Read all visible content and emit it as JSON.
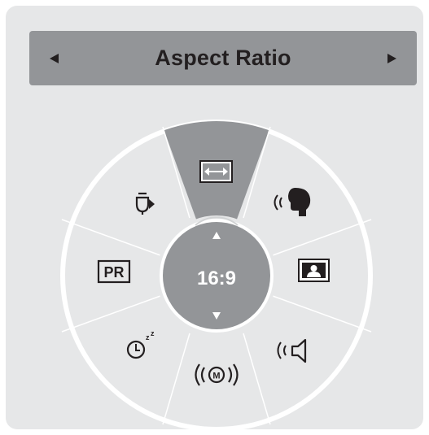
{
  "header": {
    "title": "Aspect Ratio",
    "prev_icon": "triangle-left-icon",
    "next_icon": "triangle-right-icon"
  },
  "wheel": {
    "current_value": "16:9",
    "up_icon": "triangle-up-icon",
    "down_icon": "triangle-down-icon",
    "items": [
      {
        "name": "aspect-ratio",
        "icon": "horizontal-arrows-icon",
        "selected": true
      },
      {
        "name": "picture-mode",
        "icon": "speaking-head-icon",
        "selected": false
      },
      {
        "name": "sound-mode",
        "icon": "portrait-icon",
        "selected": false
      },
      {
        "name": "speaker",
        "icon": "speaker-icon",
        "selected": false
      },
      {
        "name": "simplink",
        "icon": "m-broadcast-icon",
        "selected": false
      },
      {
        "name": "sleep-timer",
        "icon": "clock-zzz-icon",
        "selected": false
      },
      {
        "name": "program",
        "icon": "pr-icon",
        "selected": false
      },
      {
        "name": "input",
        "icon": "input-plug-icon",
        "selected": false
      }
    ]
  },
  "colors": {
    "panel": "#e6e7e8",
    "header": "#939598",
    "selected_segment": "#939598",
    "center": "#939598",
    "text_dark": "#231f20",
    "text_light": "#ffffff"
  }
}
